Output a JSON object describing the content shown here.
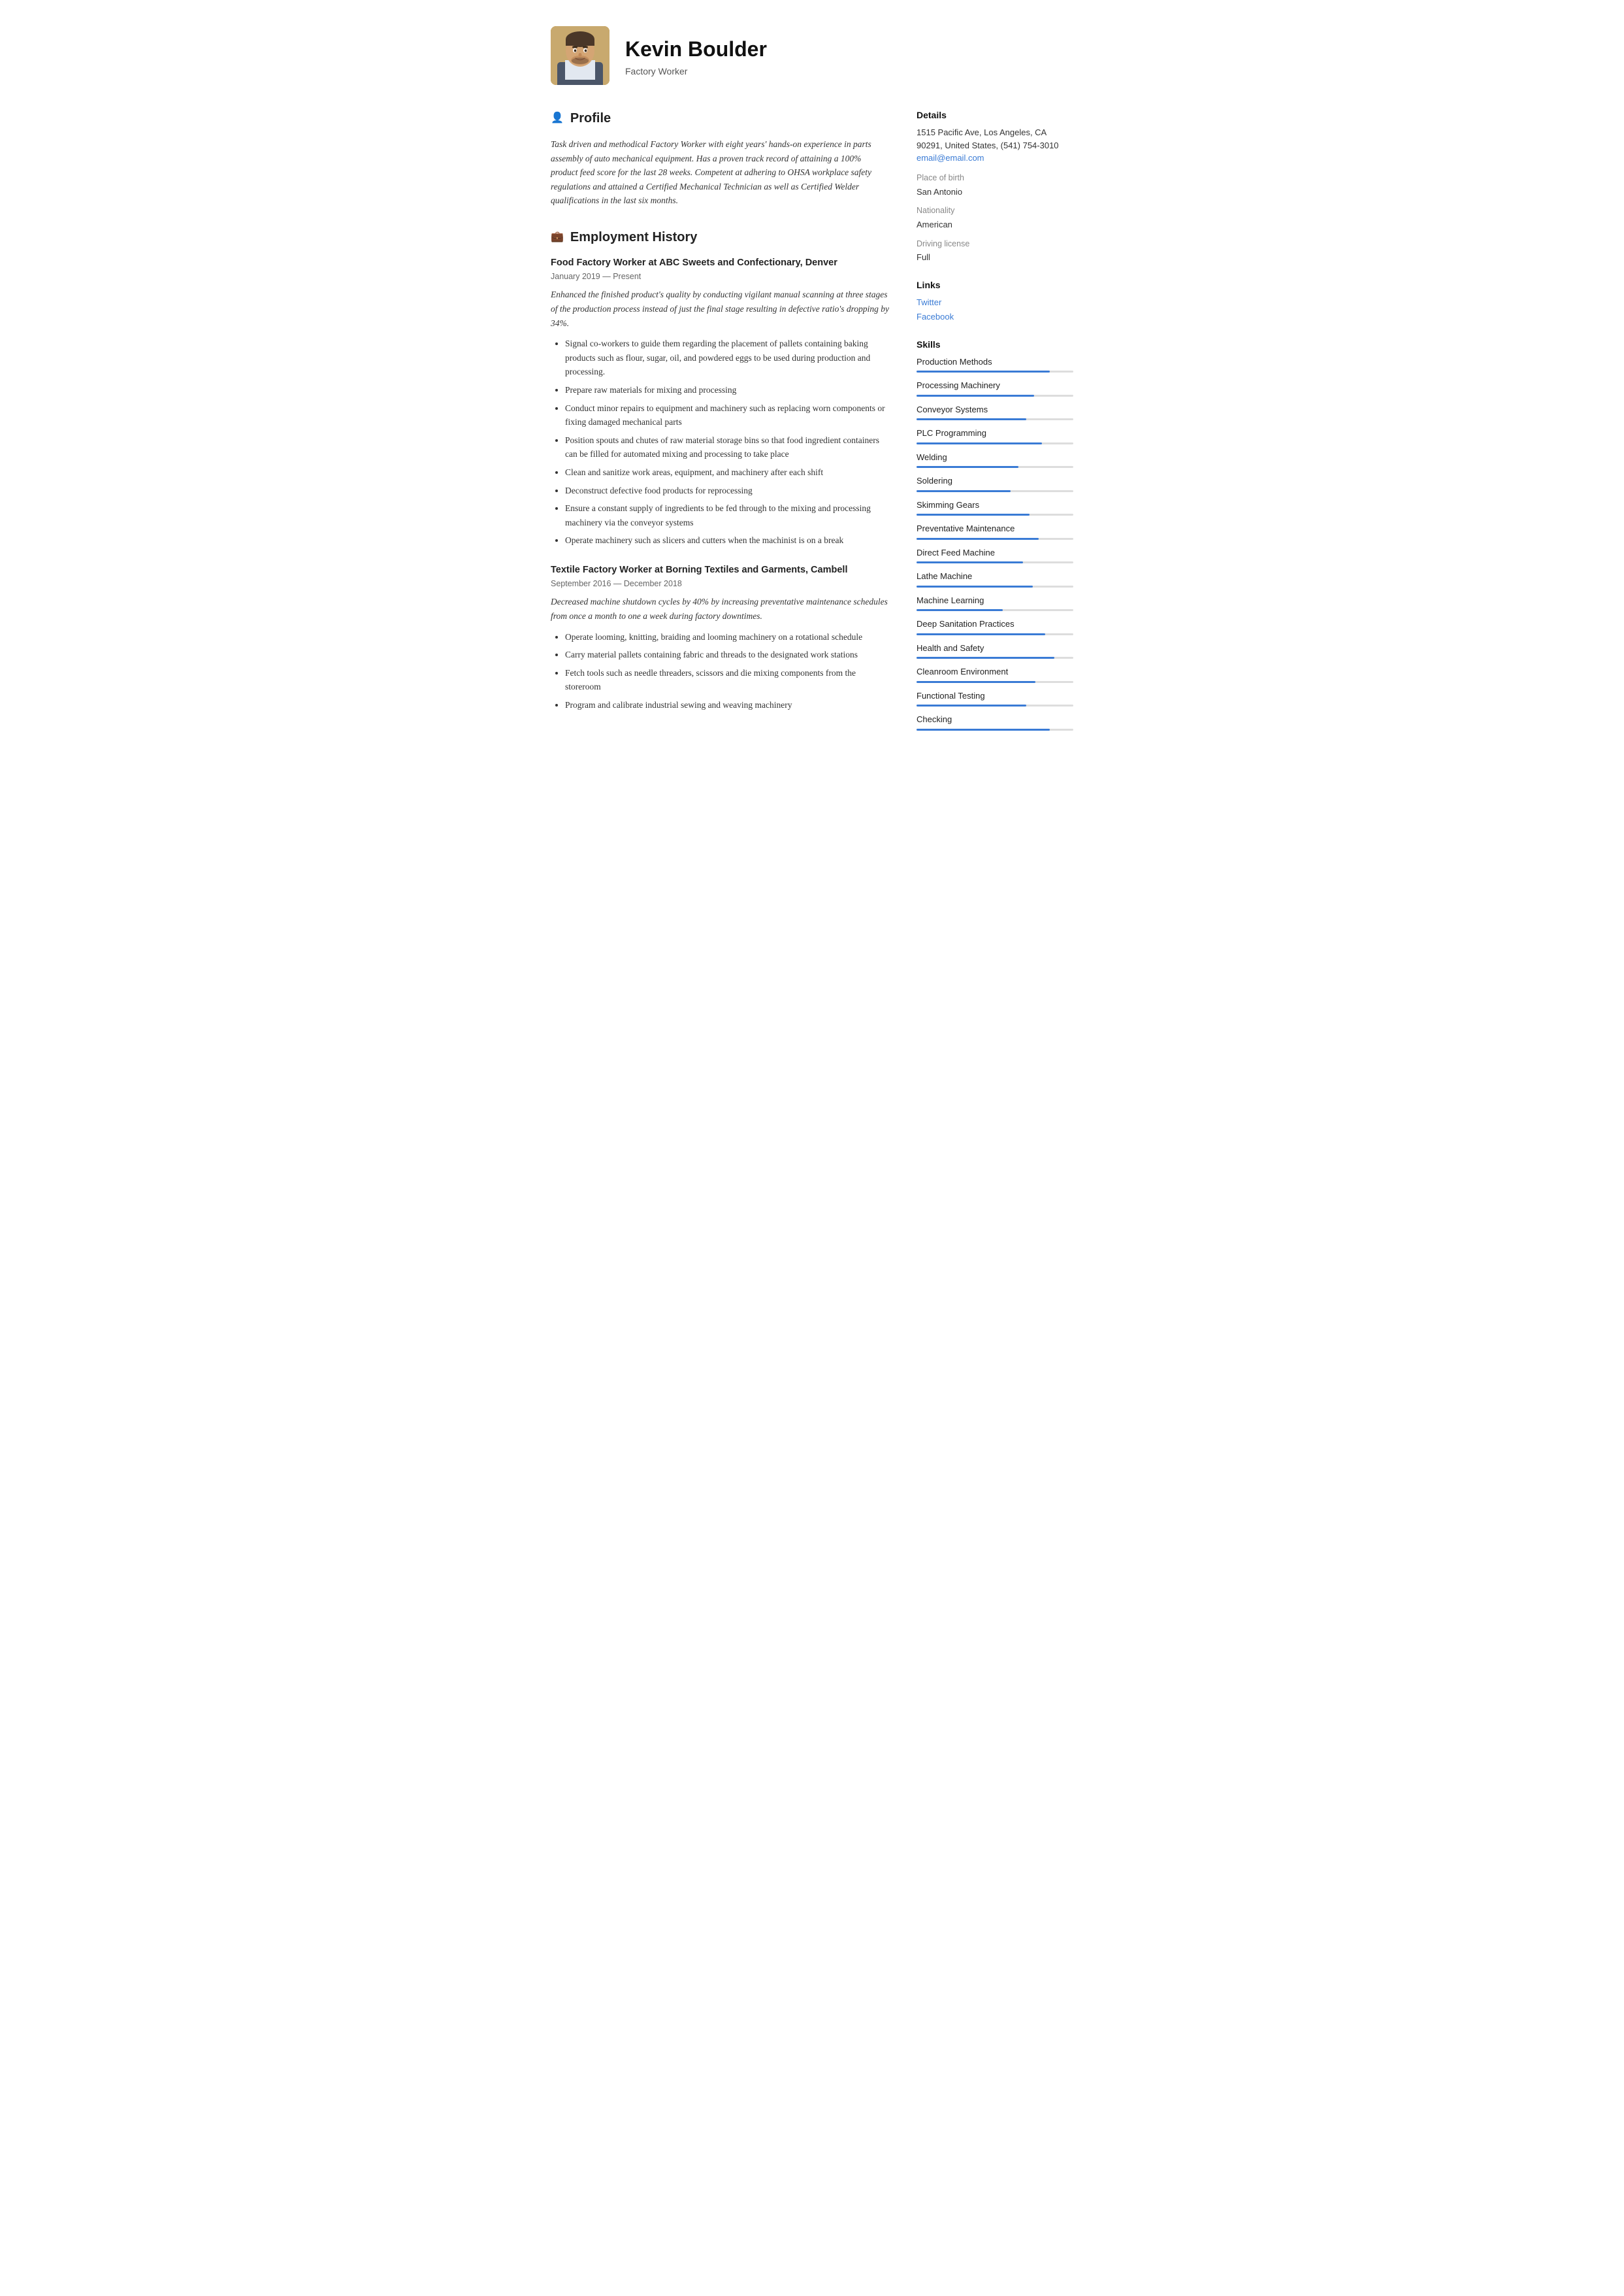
{
  "header": {
    "name": "Kevin Boulder",
    "job_title": "Factory Worker"
  },
  "profile": {
    "section_title": "Profile",
    "text": "Task driven and methodical Factory Worker with eight years' hands-on experience in parts assembly of auto mechanical equipment. Has a proven track record of attaining a 100% product feed score for the last 28 weeks. Competent at adhering to OHSA workplace safety regulations and attained a Certified Mechanical Technician as well as Certified Welder qualifications in the last six months."
  },
  "employment": {
    "section_title": "Employment History",
    "jobs": [
      {
        "title": "Food Factory Worker at",
        "company": " ABC Sweets and Confectionary, Denver",
        "dates": "January 2019 — Present",
        "description": "Enhanced the finished product's quality by conducting vigilant manual scanning at three stages of the production process instead of just the final stage resulting in defective ratio's dropping by 34%.",
        "bullets": [
          "Signal co-workers to guide them regarding the placement of pallets containing baking products such as flour, sugar, oil, and powdered eggs to be used during production and processing.",
          "Prepare raw materials for mixing and processing",
          "Conduct minor repairs to equipment and machinery such as replacing worn components or fixing damaged mechanical parts",
          "Position spouts and chutes of raw material storage bins so that food ingredient containers can be filled for automated mixing and processing to take place",
          "Clean and sanitize work areas, equipment, and machinery after each shift",
          "Deconstruct defective food products for reprocessing",
          "Ensure a constant supply of ingredients to be fed through to the mixing and processing machinery via the conveyor systems",
          "Operate machinery such as slicers and cutters when the machinist is on a break"
        ]
      },
      {
        "title": "Textile Factory Worker at",
        "company": " Borning Textiles and Garments, Cambell",
        "dates": "September 2016 — December 2018",
        "description": "Decreased machine shutdown cycles by 40% by increasing preventative maintenance schedules from once a month to one a week during factory downtimes.",
        "bullets": [
          "Operate looming, knitting, braiding and looming machinery on a rotational schedule",
          "Carry material pallets containing fabric and threads to the designated work stations",
          "Fetch tools such as needle threaders, scissors and die mixing components from the storeroom",
          "Program and calibrate industrial sewing and weaving machinery"
        ]
      }
    ]
  },
  "details": {
    "section_title": "Details",
    "address": "1515 Pacific Ave, Los Angeles, CA 90291, United States, (541) 754-3010",
    "email": "email@email.com",
    "place_of_birth_label": "Place of birth",
    "place_of_birth": "San Antonio",
    "nationality_label": "Nationality",
    "nationality": "American",
    "driving_license_label": "Driving license",
    "driving_license": "Full"
  },
  "links": {
    "section_title": "Links",
    "items": [
      {
        "label": "Twitter",
        "url": "#"
      },
      {
        "label": "Facebook",
        "url": "#"
      }
    ]
  },
  "skills": {
    "section_title": "Skills",
    "items": [
      {
        "name": "Production Methods",
        "level": 85
      },
      {
        "name": "Processing Machinery",
        "level": 75
      },
      {
        "name": "Conveyor Systems",
        "level": 70
      },
      {
        "name": "PLC Programming",
        "level": 80
      },
      {
        "name": "Welding",
        "level": 65
      },
      {
        "name": "Soldering",
        "level": 60
      },
      {
        "name": "Skimming Gears",
        "level": 72
      },
      {
        "name": "Preventative Maintenance",
        "level": 78
      },
      {
        "name": "Direct Feed Machine",
        "level": 68
      },
      {
        "name": "Lathe Machine",
        "level": 74
      },
      {
        "name": "Machine Learning",
        "level": 55
      },
      {
        "name": "Deep Sanitation Practices",
        "level": 82
      },
      {
        "name": "Health and Safety",
        "level": 88
      },
      {
        "name": "Cleanroom Environment",
        "level": 76
      },
      {
        "name": "Functional Testing",
        "level": 70
      },
      {
        "name": "Checking",
        "level": 85
      }
    ]
  }
}
